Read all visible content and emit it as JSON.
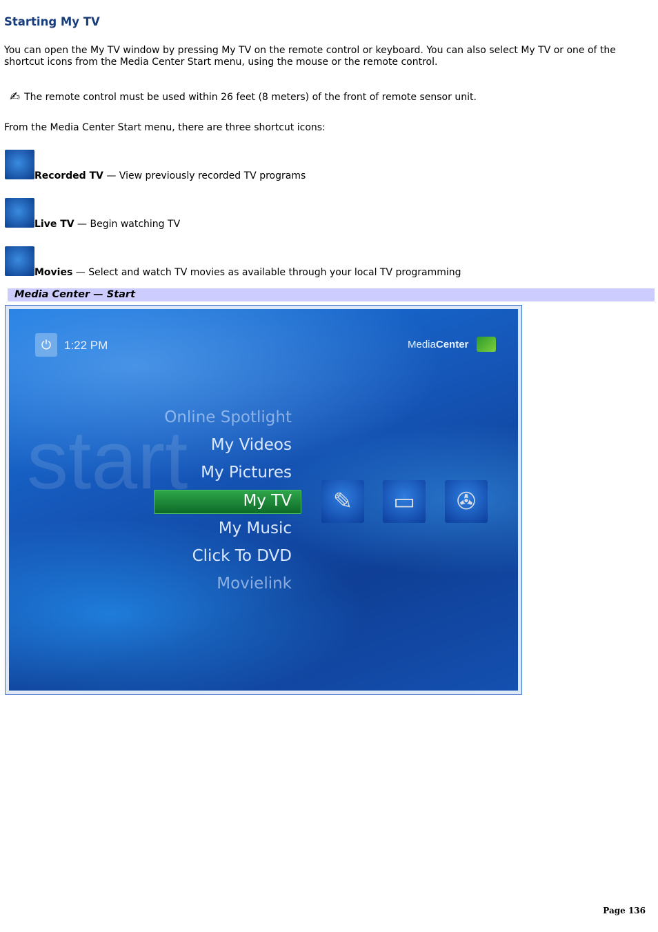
{
  "title": "Starting My TV",
  "intro": "You can open the My TV window by pressing My TV on the remote control or keyboard. You can also select My TV or one of the shortcut icons from the Media Center Start menu, using the mouse or the remote control.",
  "note": "The remote control must be used within 26 feet (8 meters) of the front of remote sensor unit.",
  "from": "From the Media Center Start menu, there are three shortcut icons:",
  "shortcuts": [
    {
      "name": "Recorded TV",
      "desc": " — View previously recorded TV programs",
      "icon": "remote-control-icon"
    },
    {
      "name": "Live TV",
      "desc": " — Begin watching TV",
      "icon": "tv-monitor-icon"
    },
    {
      "name": "Movies",
      "desc": " — Select and watch TV movies as available through your local TV programming",
      "icon": "film-reel-icon"
    }
  ],
  "caption": "Media Center — Start",
  "screen": {
    "time": "1:22 PM",
    "logo_a": "Media",
    "logo_b": "Center",
    "watermark": "start",
    "menu": [
      "Online Spotlight",
      "My Videos",
      "My Pictures",
      "My TV",
      "My Music",
      "Click To DVD",
      "Movielink"
    ],
    "selected": "My TV",
    "accent": "#1a9a3c"
  },
  "page": "Page 136"
}
